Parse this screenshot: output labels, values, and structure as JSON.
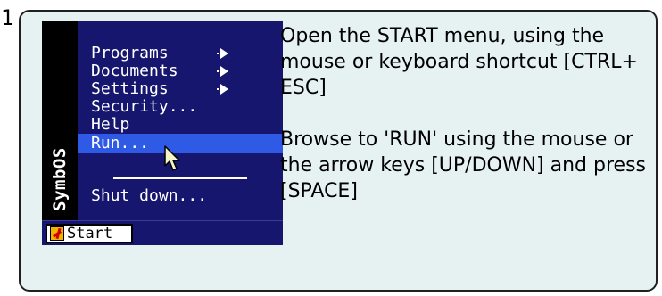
{
  "step": {
    "number": "1"
  },
  "startMenu": {
    "sidebar_text": "SymbOS",
    "items": [
      {
        "label": "Programs",
        "submenu": true
      },
      {
        "label": "Documents",
        "submenu": true
      },
      {
        "label": "Settings",
        "submenu": true
      },
      {
        "label": "Security...",
        "submenu": false
      },
      {
        "label": "Help",
        "submenu": false
      },
      {
        "label": "Run...",
        "submenu": false,
        "selected": true
      },
      {
        "label": "Shut down...",
        "submenu": false
      }
    ],
    "start_button_label": "Start"
  },
  "instructions": {
    "paragraph1": "Open the START menu, using the mouse or keyboard shortcut [CTRL+ ESC]",
    "paragraph2": "Browse to 'RUN' using the mouse or the arrow keys [UP/DOWN] and press [SPACE]"
  },
  "colors": {
    "menu_background": "#16166e",
    "selection": "#2e5ae6",
    "card_background": "#e6f2f2"
  }
}
